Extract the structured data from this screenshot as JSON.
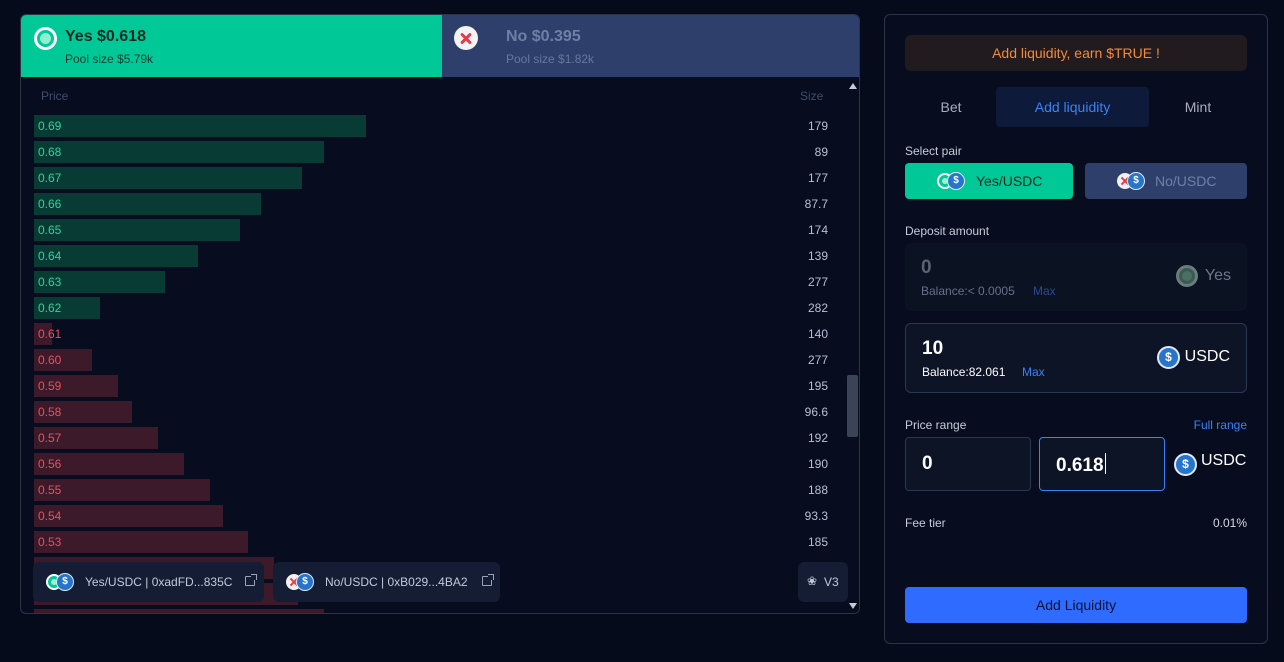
{
  "outcomes": {
    "yes": {
      "label": "Yes $0.618",
      "pool": "Pool size $5.79k"
    },
    "no": {
      "label": "No $0.395",
      "pool": "Pool size $1.82k"
    }
  },
  "orderbook": {
    "price_header": "Price",
    "size_header": "Size",
    "asks": [
      {
        "price": "0.69",
        "size": "179"
      },
      {
        "price": "0.68",
        "size": "89"
      },
      {
        "price": "0.67",
        "size": "177"
      },
      {
        "price": "0.66",
        "size": "87.7"
      },
      {
        "price": "0.65",
        "size": "174"
      },
      {
        "price": "0.64",
        "size": "139"
      },
      {
        "price": "0.63",
        "size": "277"
      },
      {
        "price": "0.62",
        "size": "282"
      }
    ],
    "bids": [
      {
        "price": "0.61",
        "size": "140"
      },
      {
        "price": "0.60",
        "size": "277"
      },
      {
        "price": "0.59",
        "size": "195"
      },
      {
        "price": "0.58",
        "size": "96.6"
      },
      {
        "price": "0.57",
        "size": "192"
      },
      {
        "price": "0.56",
        "size": "190"
      },
      {
        "price": "0.55",
        "size": "188"
      },
      {
        "price": "0.54",
        "size": "93.3"
      },
      {
        "price": "0.53",
        "size": "185"
      },
      {
        "price": "",
        "size": ""
      },
      {
        "price": "",
        "size": ""
      },
      {
        "price": "",
        "size": ""
      }
    ],
    "bar_fractions_asks": [
      0.415,
      0.363,
      0.335,
      0.284,
      0.258,
      0.205,
      0.164,
      0.083
    ],
    "bar_fractions_bids": [
      0.023,
      0.072,
      0.105,
      0.123,
      0.155,
      0.188,
      0.22,
      0.236,
      0.268,
      0.3,
      0.33,
      0.363
    ]
  },
  "pools": {
    "yes_pool": "Yes/USDC | 0xadFD...835C",
    "no_pool": "No/USDC | 0xB029...4BA2",
    "version": "V3"
  },
  "panel": {
    "banner": "Add liquidity, earn $TRUE !",
    "tabs": [
      "Bet",
      "Add liquidity",
      "Mint"
    ],
    "active_tab": "Add liquidity",
    "select_pair_label": "Select pair",
    "pair_yes": "Yes/USDC",
    "pair_no": "No/USDC",
    "deposit_label": "Deposit amount",
    "deposit_yes": {
      "amount": "0",
      "balance": "Balance:< 0.0005",
      "max": "Max",
      "token": "Yes"
    },
    "deposit_usdc": {
      "amount": "10",
      "balance": "Balance:82.061",
      "max": "Max",
      "token": "USDC"
    },
    "price_range_label": "Price range",
    "full_range": "Full range",
    "range_min": "0",
    "range_max": "0.618",
    "range_token": "USDC",
    "fee_label": "Fee tier",
    "fee_value": "0.01%",
    "submit": "Add Liquidity"
  },
  "icons": {
    "yes": "yes-outcome-icon",
    "no": "no-outcome-icon",
    "usdc": "usdc-icon",
    "external": "external-link-icon",
    "uniswap": "uniswap-icon"
  },
  "colors": {
    "yes": "#00c896",
    "no": "#2e3f6b",
    "accent": "#3b82f6",
    "banner_text": "#f08c3c"
  }
}
